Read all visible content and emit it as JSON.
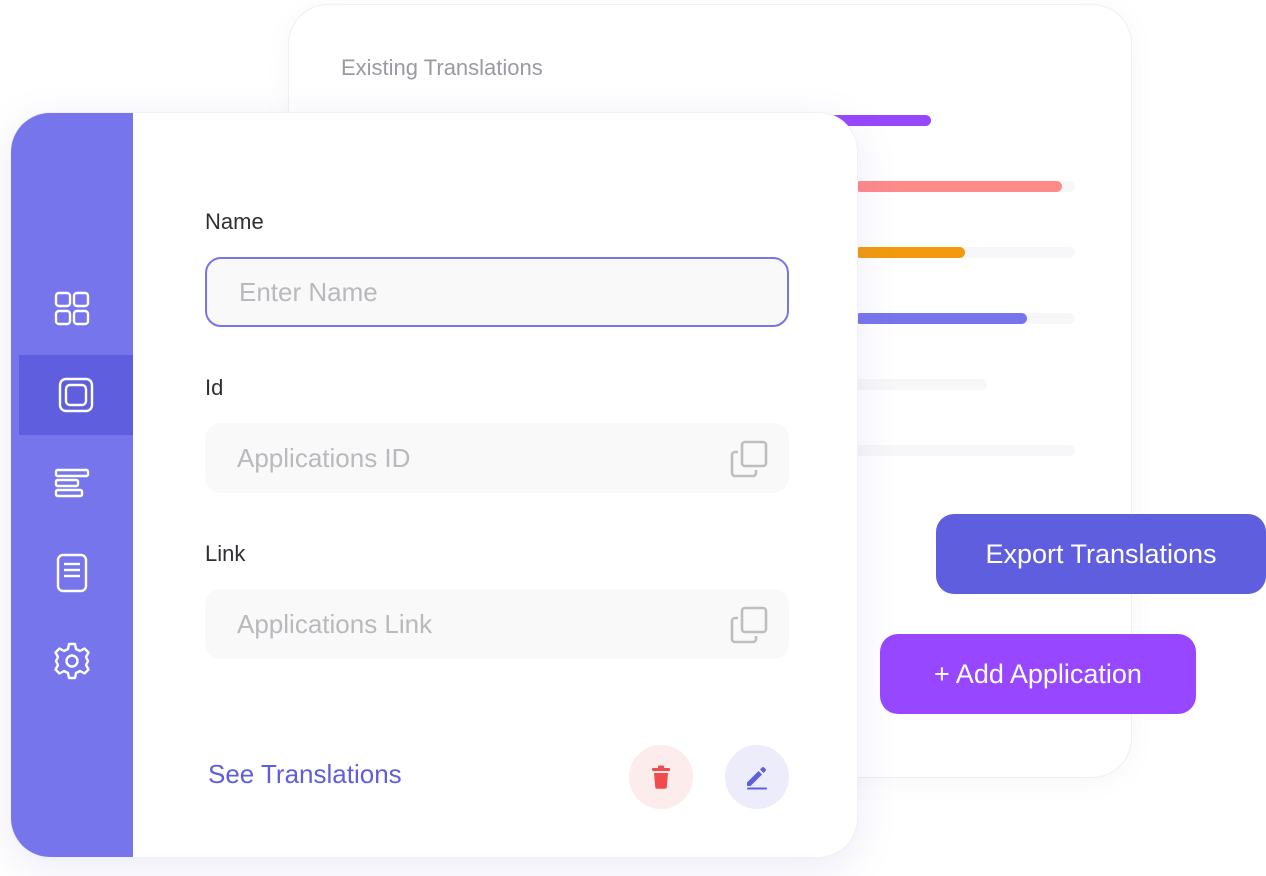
{
  "existing": {
    "title": "Existing Translations",
    "bars": [
      {
        "color": "#9747ff",
        "fill": 1.0
      },
      {
        "color": "#ff8a8a",
        "fill": 0.93
      },
      {
        "color": "#f29a0c",
        "fill": 0.61
      },
      {
        "color": "#7775ec",
        "fill": 0.85
      },
      {
        "color": "",
        "fill": 0
      },
      {
        "color": "",
        "fill": 0
      }
    ]
  },
  "sidebar": {
    "accent": "#7775ec",
    "active_accent": "#5f5ede",
    "items": [
      {
        "icon": "grid-icon",
        "active": false
      },
      {
        "icon": "square-icon",
        "active": true
      },
      {
        "icon": "align-left-icon",
        "active": false
      },
      {
        "icon": "document-icon",
        "active": false
      },
      {
        "icon": "gear-icon",
        "active": false
      }
    ]
  },
  "form": {
    "name_label": "Name",
    "name_placeholder": "Enter Name",
    "name_value": "",
    "id_label": "Id",
    "id_placeholder": "Applications ID",
    "link_label": "Link",
    "link_placeholder": "Applications Link"
  },
  "actions": {
    "see_translations": "See Translations",
    "delete_icon": "trash-icon",
    "edit_icon": "pencil-icon"
  },
  "buttons": {
    "export": "Export Translations",
    "add": "+ Add Application"
  }
}
